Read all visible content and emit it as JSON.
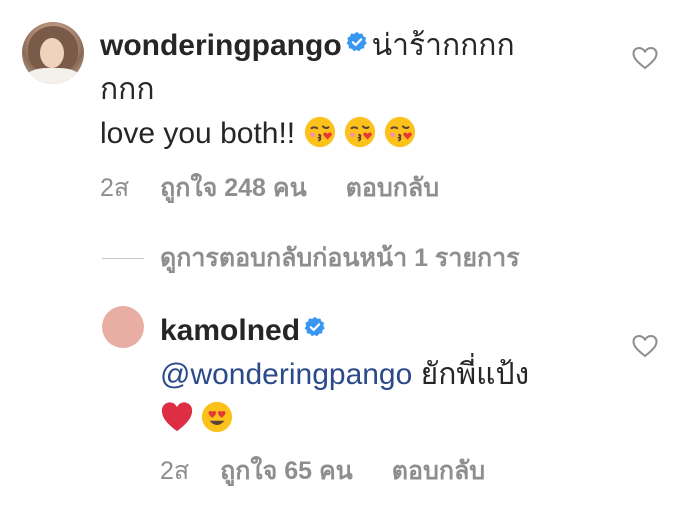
{
  "comment": {
    "username": "wonderingpango",
    "text_line1": "น่าร้ากกกก",
    "text_line2": "กกก",
    "text_line3": "love you both!!",
    "emojis": [
      "kissing-heart",
      "kissing-heart",
      "kissing-heart"
    ],
    "time": "2ส",
    "likes": "ถูกใจ 248 คน",
    "reply_label": "ตอบกลับ",
    "verified": true
  },
  "view_previous_replies": "ดูการตอบกลับก่อนหน้า 1 รายการ",
  "reply": {
    "username": "kamolned",
    "mention": "@wonderingpango",
    "text": "ยักพี่แป้ง",
    "emojis": [
      "red-heart",
      "heart-eyes"
    ],
    "time": "2ส",
    "likes": "ถูกใจ 65 คน",
    "reply_label": "ตอบกลับ",
    "verified": true
  },
  "colors": {
    "verified_badge": "#3897f0",
    "muted_text": "#8e8e8e",
    "mention": "#2b4a8a",
    "reply_avatar": "#e8aea3"
  }
}
